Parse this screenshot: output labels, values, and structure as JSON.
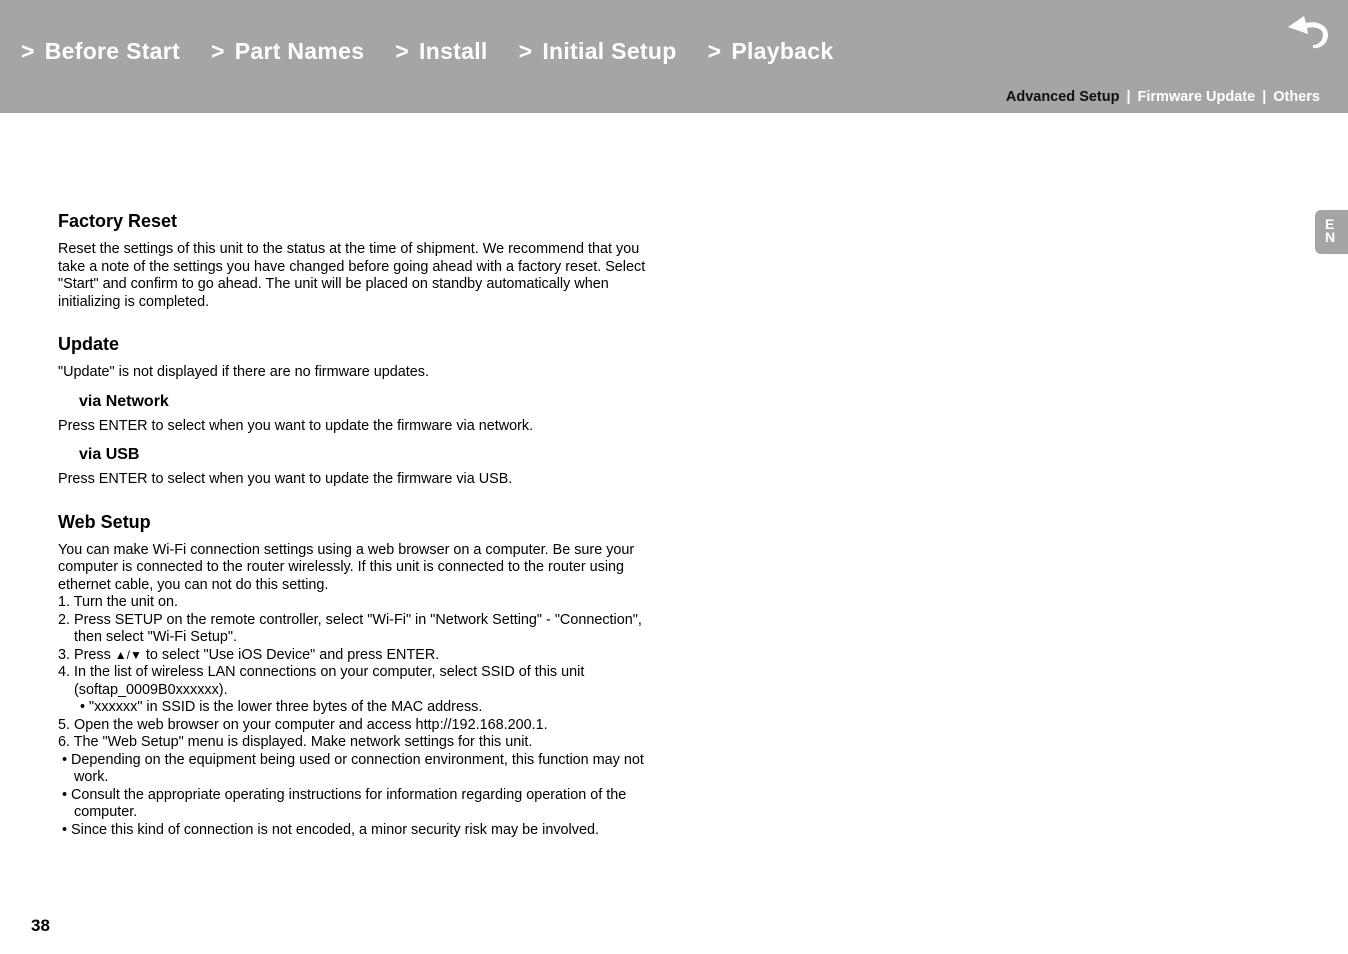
{
  "header": {
    "nav": [
      {
        "chevron": ">",
        "label": "Before Start"
      },
      {
        "chevron": ">",
        "label": "Part Names"
      },
      {
        "chevron": ">",
        "label": "Install"
      },
      {
        "chevron": ">",
        "label": "Initial Setup"
      },
      {
        "chevron": ">",
        "label": "Playback"
      }
    ],
    "back_icon": "return-arrow-icon",
    "subnav": {
      "items": [
        "Advanced Setup",
        "Firmware Update",
        "Others"
      ],
      "active": "Advanced Setup",
      "separator": "|"
    }
  },
  "language_tab": {
    "letters": [
      "E",
      "N"
    ]
  },
  "sections": {
    "factory_reset": {
      "title": "Factory Reset",
      "body": "Reset the settings of this unit to the status at the time of shipment. We recommend that you take a note of the settings you have changed before going ahead with a factory reset. Select \"Start\" and confirm to go ahead. The unit will be placed on standby automatically when initializing is completed."
    },
    "update": {
      "title": "Update",
      "body": "\"Update\" is not displayed if there are no firmware updates.",
      "via_network": {
        "title": "via Network",
        "body": "Press ENTER to select when you want to update the firmware via network."
      },
      "via_usb": {
        "title": "via USB",
        "body": "Press ENTER to select when you want to update the firmware via USB."
      }
    },
    "web_setup": {
      "title": "Web Setup",
      "intro": "You can make Wi-Fi connection settings using a web browser on a computer. Be sure your computer is connected to the router wirelessly. If this unit is connected to the router using ethernet cable, you can not do this setting.",
      "steps": [
        "1. Turn the unit on.",
        "2. Press SETUP on the remote controller, select \"Wi-Fi\" in \"Network Setting\" - \"Connection\", then select \"Wi-Fi Setup\".",
        "3. Press ↑/↓ to select \"Use iOS Device\" and press ENTER.",
        "4. In the list of wireless LAN connections on your computer, select SSID of this unit (softap_0009B0xxxxxx).",
        "5. Open the web browser on your computer and access http://192.168.200.1.",
        "6. The \"Web Setup\" menu is displayed. Make network settings for this unit."
      ],
      "step3_parts": {
        "before": "3. Press ",
        "arrows": "▲/▼",
        "after": " to select \"Use iOS Device\" and press ENTER."
      },
      "step4_note": "• \"xxxxxx\" in SSID is the lower three bytes of the MAC address.",
      "notes": [
        "• Depending on the equipment being used or connection environment, this function may not work.",
        "• Consult the appropriate operating instructions for information regarding operation of the computer.",
        "• Since this kind of connection is not encoded, a minor security risk may be involved."
      ]
    }
  },
  "page_number": "38"
}
